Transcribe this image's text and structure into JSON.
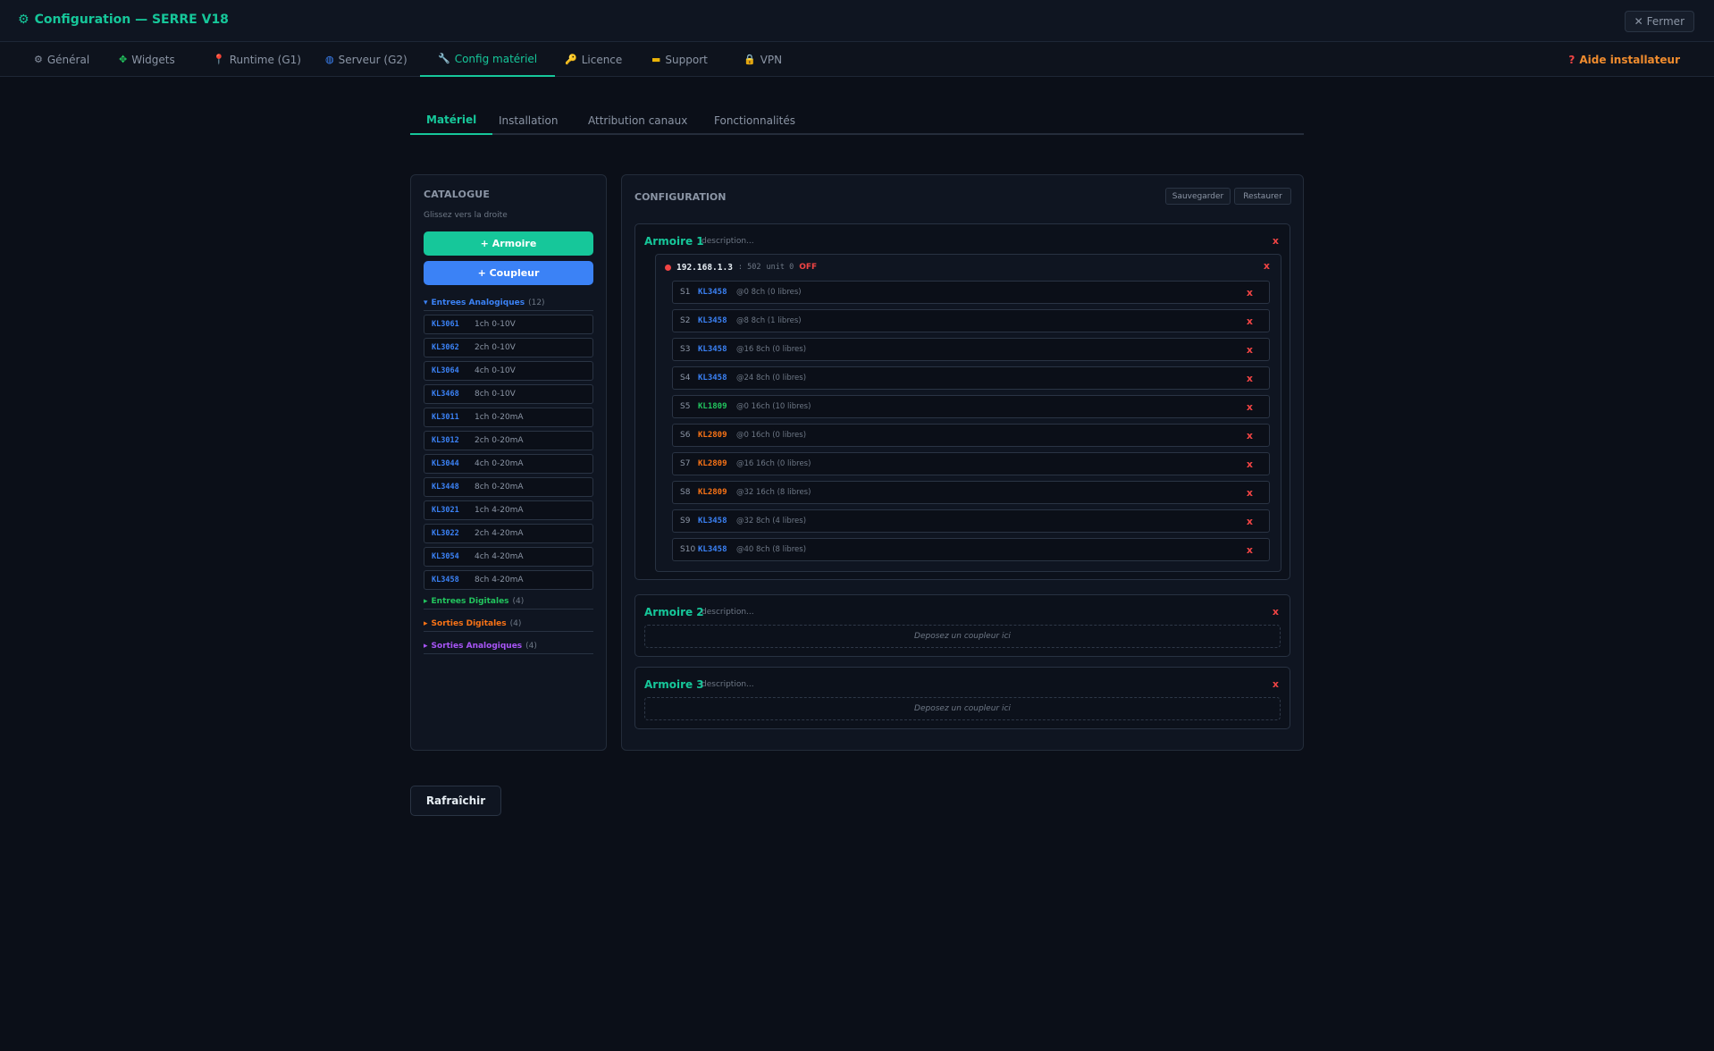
{
  "header": {
    "title": "Configuration — SERRE V18",
    "title_icon": "gear-icon",
    "close_label": "Fermer"
  },
  "tabs": [
    {
      "label": "Général",
      "icon": "gear-icon"
    },
    {
      "label": "Widgets",
      "icon": "puzzle-icon"
    },
    {
      "label": "Runtime (G1)",
      "icon": "pin-icon"
    },
    {
      "label": "Serveur (G2)",
      "icon": "globe-icon"
    },
    {
      "label": "Config matériel",
      "icon": "wrench-icon",
      "active": true
    },
    {
      "label": "Licence",
      "icon": "key-icon"
    },
    {
      "label": "Support",
      "icon": "card-icon"
    },
    {
      "label": "VPN",
      "icon": "lock-icon"
    }
  ],
  "help_label": "Aide installateur",
  "subtabs": [
    "Matériel",
    "Installation",
    "Attribution canaux",
    "Fonctionnalités"
  ],
  "catalogue": {
    "title": "CATALOGUE",
    "hint": "Glissez vers la droite",
    "add_armoire": "+ Armoire",
    "add_coupleur": "+ Coupleur",
    "groups": [
      {
        "arrow": "▾",
        "label": "Entrees Analogiques",
        "count": "(12)",
        "color": "#3b82f6"
      },
      {
        "arrow": "▸",
        "label": "Entrees Digitales",
        "count": "(4)",
        "color": "#22c55e"
      },
      {
        "arrow": "▸",
        "label": "Sorties Digitales",
        "count": "(4)",
        "color": "#f97316"
      },
      {
        "arrow": "▸",
        "label": "Sorties Analogiques",
        "count": "(4)",
        "color": "#a855f7"
      }
    ],
    "items": [
      {
        "code": "KL3061",
        "desc": "1ch 0-10V"
      },
      {
        "code": "KL3062",
        "desc": "2ch 0-10V"
      },
      {
        "code": "KL3064",
        "desc": "4ch 0-10V"
      },
      {
        "code": "KL3468",
        "desc": "8ch 0-10V"
      },
      {
        "code": "KL3011",
        "desc": "1ch 0-20mA"
      },
      {
        "code": "KL3012",
        "desc": "2ch 0-20mA"
      },
      {
        "code": "KL3044",
        "desc": "4ch 0-20mA"
      },
      {
        "code": "KL3448",
        "desc": "8ch 0-20mA"
      },
      {
        "code": "KL3021",
        "desc": "1ch 4-20mA"
      },
      {
        "code": "KL3022",
        "desc": "2ch 4-20mA"
      },
      {
        "code": "KL3054",
        "desc": "4ch 4-20mA"
      },
      {
        "code": "KL3458",
        "desc": "8ch 4-20mA"
      }
    ]
  },
  "config": {
    "title": "CONFIGURATION",
    "save_label": "Sauvegarder",
    "restore_label": "Restaurer",
    "delete_mark": "x",
    "armoires": [
      {
        "name": "Armoire 1",
        "description": "description...",
        "coupleur": {
          "ip": "192.168.1.3",
          "port": ": 502",
          "unit": "unit 0",
          "state": "OFF"
        },
        "slots": [
          {
            "slot": "S1",
            "module": "KL3458",
            "info": "@0 8ch (0 libres)",
            "color": "#3b82f6"
          },
          {
            "slot": "S2",
            "module": "KL3458",
            "info": "@8 8ch (1 libres)",
            "color": "#3b82f6"
          },
          {
            "slot": "S3",
            "module": "KL3458",
            "info": "@16 8ch (0 libres)",
            "color": "#3b82f6"
          },
          {
            "slot": "S4",
            "module": "KL3458",
            "info": "@24 8ch (0 libres)",
            "color": "#3b82f6"
          },
          {
            "slot": "S5",
            "module": "KL1809",
            "info": "@0 16ch (10 libres)",
            "color": "#22c55e"
          },
          {
            "slot": "S6",
            "module": "KL2809",
            "info": "@0 16ch (0 libres)",
            "color": "#f97316"
          },
          {
            "slot": "S7",
            "module": "KL2809",
            "info": "@16 16ch (0 libres)",
            "color": "#f97316"
          },
          {
            "slot": "S8",
            "module": "KL2809",
            "info": "@32 16ch (8 libres)",
            "color": "#f97316"
          },
          {
            "slot": "S9",
            "module": "KL3458",
            "info": "@32 8ch (4 libres)",
            "color": "#3b82f6"
          },
          {
            "slot": "S10",
            "module": "KL3458",
            "info": "@40 8ch (8 libres)",
            "color": "#3b82f6"
          }
        ]
      },
      {
        "name": "Armoire 2",
        "description": "description...",
        "drop_hint": "Deposez un coupleur ici"
      },
      {
        "name": "Armoire 3",
        "description": "description...",
        "drop_hint": "Deposez un coupleur ici"
      }
    ]
  },
  "refresh_label": "Rafraîchir",
  "colors": {
    "accent": "#16c79a",
    "analog_in": "#3b82f6",
    "digital_in": "#22c55e",
    "digital_out": "#f97316",
    "analog_out": "#a855f7",
    "danger": "#f04444",
    "help": "#f08c2e"
  }
}
